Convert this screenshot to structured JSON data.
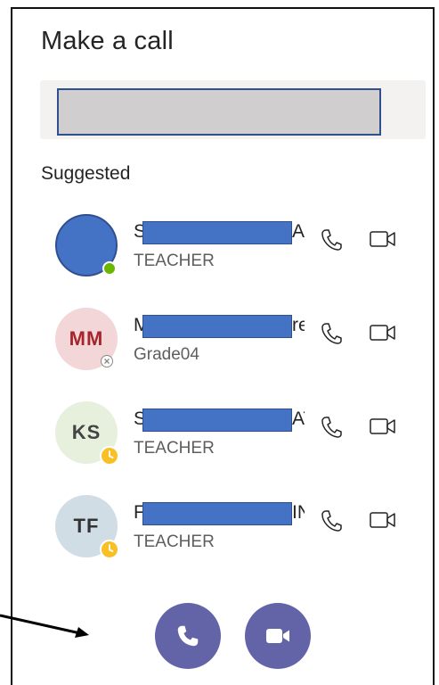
{
  "panel": {
    "title": "Make a call",
    "section_label": "Suggested"
  },
  "contacts": [
    {
      "initials": "",
      "name_first": "S",
      "name_last": "AI",
      "subtitle": "TEACHER",
      "status": "available"
    },
    {
      "initials": "MM",
      "name_first": "M",
      "name_last": "re",
      "subtitle": "Grade04",
      "status": "offline"
    },
    {
      "initials": "KS",
      "name_first": "S",
      "name_last": "AT",
      "subtitle": "TEACHER",
      "status": "away"
    },
    {
      "initials": "TF",
      "name_first": "F",
      "name_last": "IN",
      "subtitle": "TEACHER",
      "status": "away"
    }
  ],
  "icons": {
    "row_call": "phone-icon",
    "row_video": "video-camera-icon",
    "fab_call": "phone-icon",
    "fab_video": "video-camera-icon"
  },
  "colors": {
    "accent": "#6264a7",
    "redaction": "#4472c4",
    "available": "#6bb700",
    "away": "#f8c024"
  }
}
